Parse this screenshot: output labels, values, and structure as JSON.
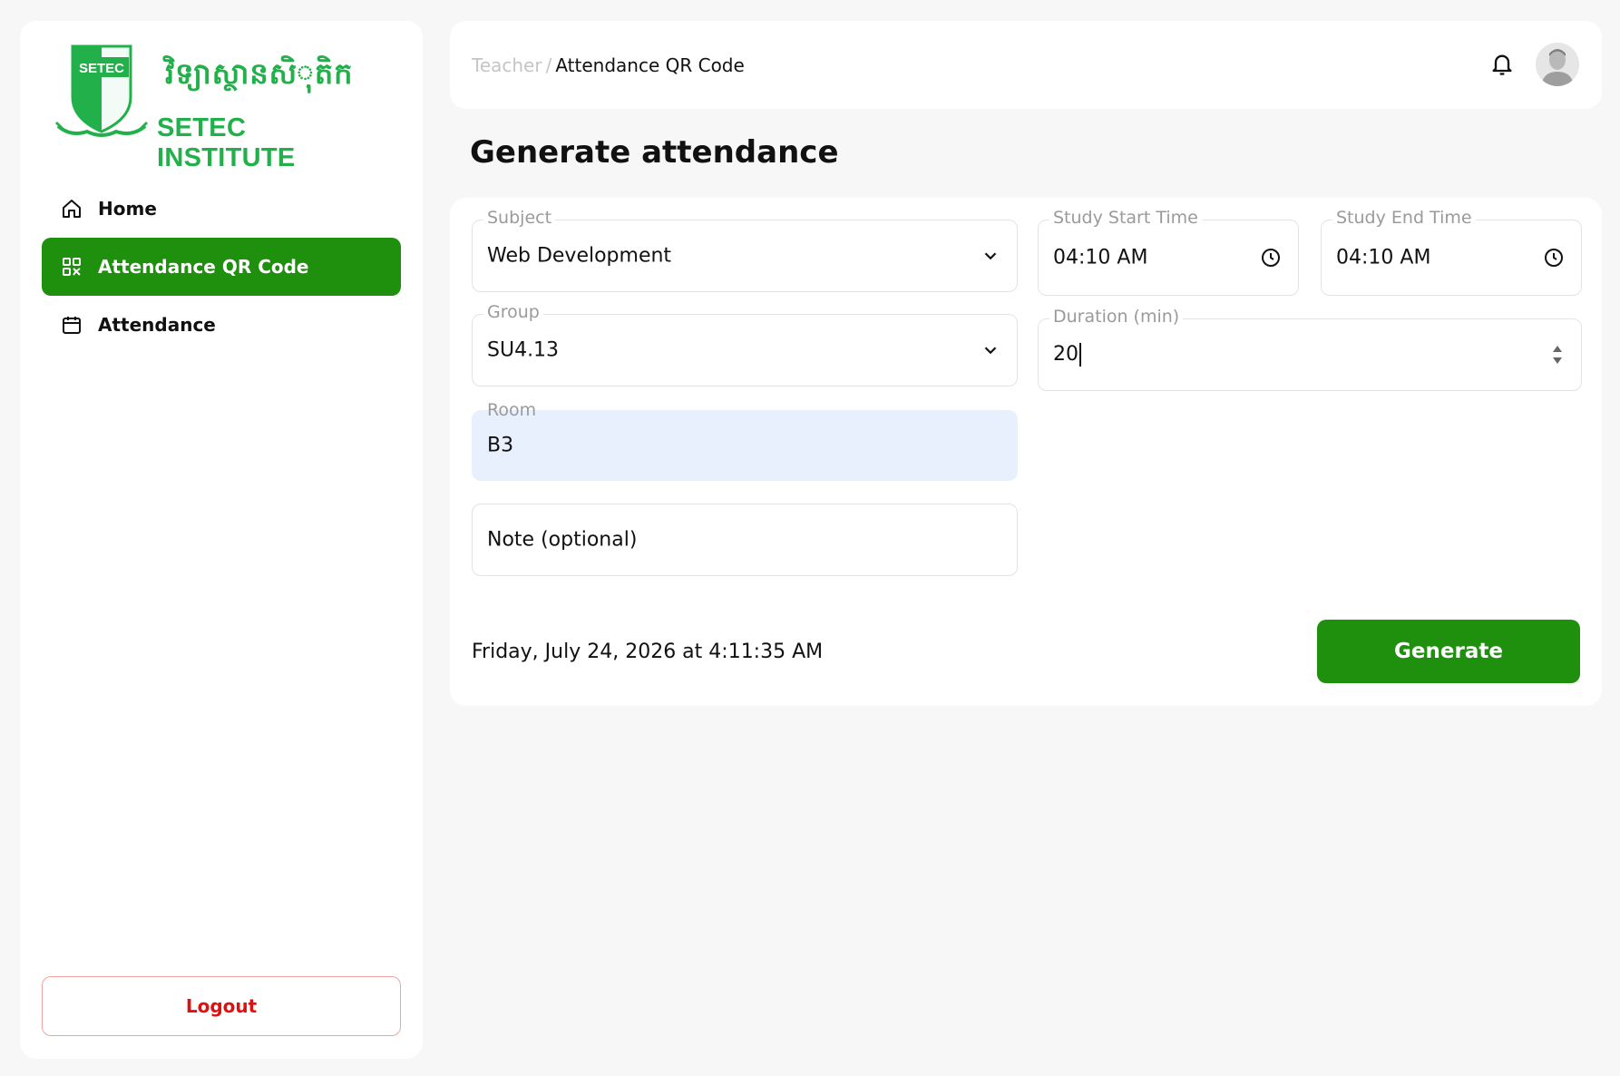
{
  "brand": {
    "khmer_name": "វិទ្យាស្ថានសិុតិក",
    "english_name": "SETEC INSTITUTE",
    "shield_text": "SETEC",
    "color": "#22b04b"
  },
  "sidebar": {
    "items": [
      {
        "label": "Home",
        "icon": "home-icon",
        "active": false
      },
      {
        "label": "Attendance QR Code",
        "icon": "qr-code-icon",
        "active": true
      },
      {
        "label": "Attendance",
        "icon": "calendar-icon",
        "active": false
      }
    ],
    "logout_label": "Logout",
    "active_color": "#1f8f0e"
  },
  "header": {
    "breadcrumb_root": "Teacher",
    "breadcrumb_separator": "/",
    "breadcrumb_current": "Attendance QR Code",
    "notifications_icon": "bell-icon",
    "avatar_icon": "user-avatar"
  },
  "main": {
    "title": "Generate attendance",
    "form": {
      "subject": {
        "label": "Subject",
        "value": "Web Development"
      },
      "group": {
        "label": "Group",
        "value": "SU4.13"
      },
      "room": {
        "label": "Room",
        "value": "B3"
      },
      "note": {
        "placeholder": "Note (optional)"
      },
      "start_time": {
        "label": "Study Start Time",
        "value": "04:10 AM"
      },
      "end_time": {
        "label": "Study End Time",
        "value": "04:10 AM"
      },
      "duration": {
        "label": "Duration (min)",
        "value": "20"
      }
    },
    "current_datetime": "Friday, July 24, 2026 at 4:11:35 AM",
    "generate_label": "Generate"
  }
}
